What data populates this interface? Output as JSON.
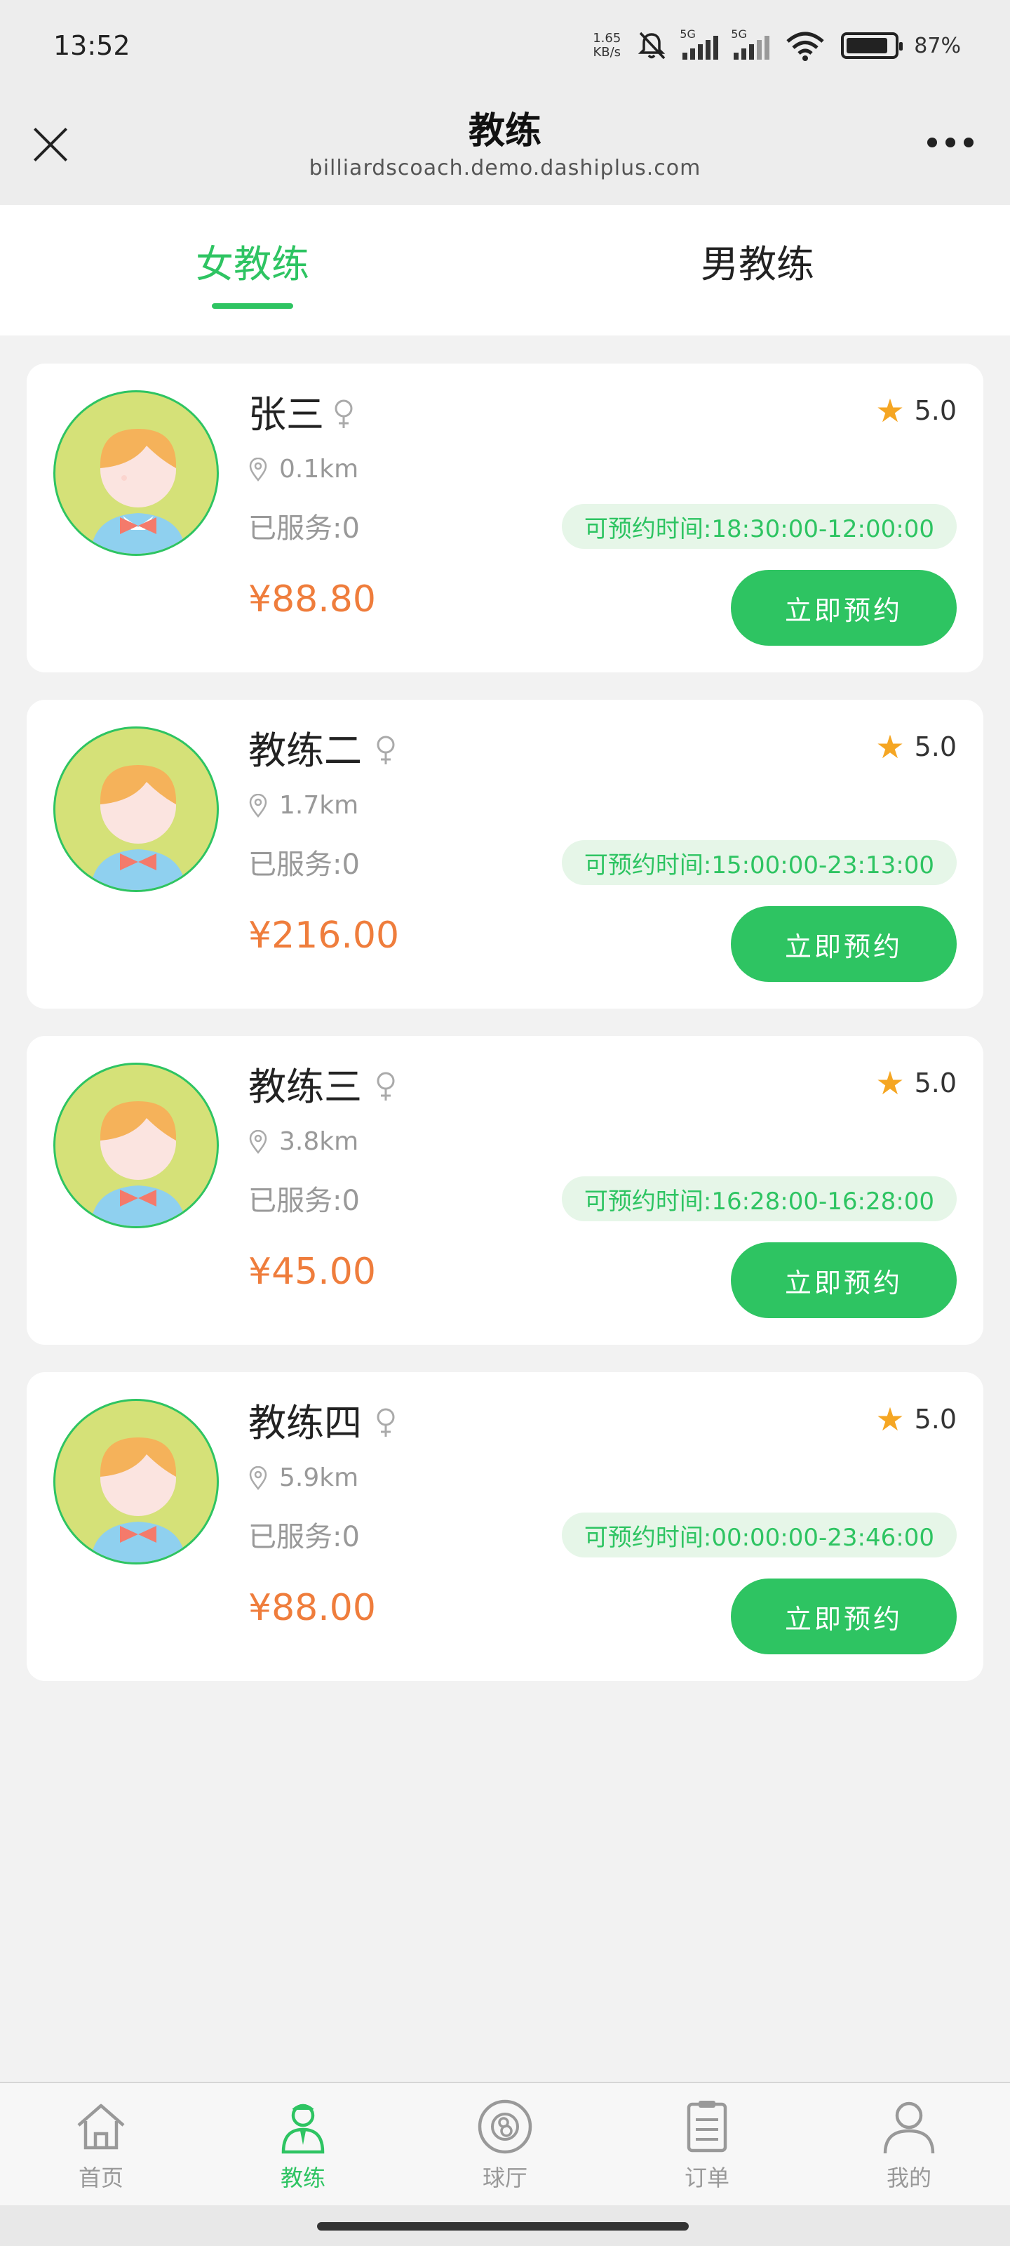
{
  "status_bar": {
    "time": "13:52",
    "net_speed_value": "1.65",
    "net_speed_unit": "KB/s",
    "signal1_label": "5G",
    "signal2_label": "5G",
    "battery_pct": "87"
  },
  "header": {
    "title": "教练",
    "url": "billiardscoach.demo.dashiplus.com"
  },
  "tabs": [
    {
      "label": "女教练",
      "active": true
    },
    {
      "label": "男教练",
      "active": false
    }
  ],
  "coaches": [
    {
      "name": "张三",
      "gender": "female",
      "rating": "5.0",
      "distance": "0.1km",
      "served": "已服务:0",
      "available": "可预约时间:18:30:00-12:00:00",
      "price": "¥88.80",
      "book_label": "立即预约"
    },
    {
      "name": "教练二",
      "gender": "female",
      "rating": "5.0",
      "distance": "1.7km",
      "served": "已服务:0",
      "available": "可预约时间:15:00:00-23:13:00",
      "price": "¥216.00",
      "book_label": "立即预约"
    },
    {
      "name": "教练三",
      "gender": "female",
      "rating": "5.0",
      "distance": "3.8km",
      "served": "已服务:0",
      "available": "可预约时间:16:28:00-16:28:00",
      "price": "¥45.00",
      "book_label": "立即预约"
    },
    {
      "name": "教练四",
      "gender": "female",
      "rating": "5.0",
      "distance": "5.9km",
      "served": "已服务:0",
      "available": "可预约时间:00:00:00-23:46:00",
      "price": "¥88.00",
      "book_label": "立即预约"
    }
  ],
  "bottom_nav": [
    {
      "label": "首页",
      "icon": "home-icon",
      "active": false
    },
    {
      "label": "教练",
      "icon": "coach-icon",
      "active": true
    },
    {
      "label": "球厅",
      "icon": "billiard-ball-icon",
      "active": false
    },
    {
      "label": "订单",
      "icon": "order-list-icon",
      "active": false
    },
    {
      "label": "我的",
      "icon": "profile-icon",
      "active": false
    }
  ],
  "colors": {
    "accent": "#2ec462",
    "price": "#ef7d3c",
    "star": "#f5a623",
    "badge_bg": "#e6f6e8"
  }
}
